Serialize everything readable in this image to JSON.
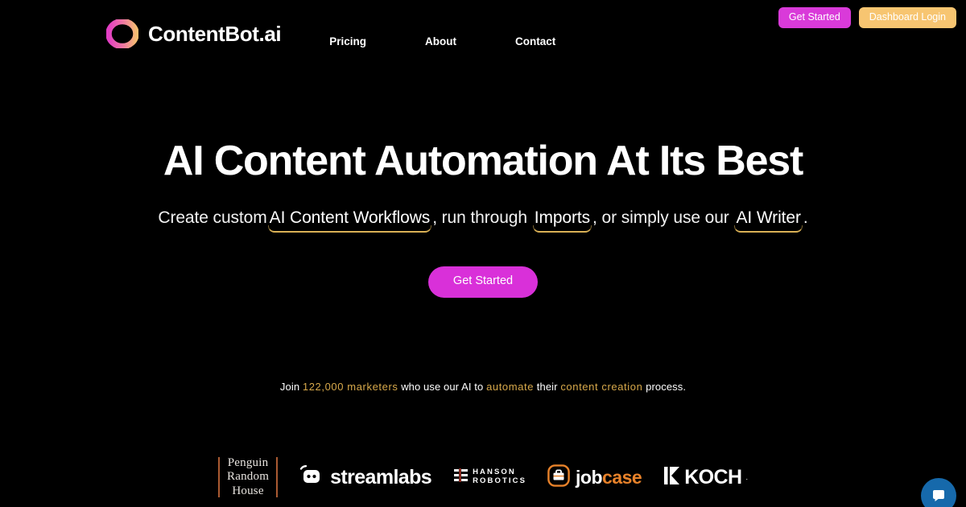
{
  "brand": {
    "name": "ContentBot.ai",
    "logo_icon": "gradient-ring-icon",
    "gradient_start": "#e23ec4",
    "gradient_end": "#f6bd72"
  },
  "nav": {
    "items": [
      {
        "label": "Pricing"
      },
      {
        "label": "About"
      },
      {
        "label": "Contact"
      }
    ]
  },
  "auth": {
    "get_started_label": "Get Started",
    "get_started_color": "#d93ad9",
    "dashboard_login_label": "Dashboard Login",
    "dashboard_login_color": "#f7c571"
  },
  "hero": {
    "title": "AI Content Automation At Its Best",
    "subtitle": {
      "part1": "Create custom",
      "link1": "AI Content Workflows",
      "part2": ", run through",
      "link2": "Imports",
      "part3": ", or simply use our",
      "link3": "AI Writer",
      "part4": ".",
      "underline_color": "#d9b055"
    },
    "cta_label": "Get Started",
    "cta_color": "#d930d9"
  },
  "social_proof": {
    "part1": "Join",
    "highlight1": "122,000 marketers",
    "part2": "who use our AI to",
    "highlight2": "automate",
    "part3": "their",
    "highlight3": "content creation",
    "part4": "process.",
    "highlight_color": "#d8a94b"
  },
  "logos": {
    "penguin": {
      "line1": "Penguin",
      "line2": "Random",
      "line3": "House",
      "rule_color": "#b35f35"
    },
    "streamlabs": {
      "name": "streamlabs",
      "icon": "streamlabs-face-icon"
    },
    "hanson": {
      "line1": "HANSON",
      "line2": "ROBOTICS",
      "icon": "hanson-grid-icon",
      "accent": "#c0392b"
    },
    "jobcase": {
      "name_part1": "job",
      "name_part2": "case",
      "icon": "jobcase-briefcase-icon",
      "accent": "#e8822a"
    },
    "koch": {
      "name": "KOCH",
      "trademark": ".",
      "icon": "koch-chevron-icon"
    }
  },
  "chat": {
    "icon": "chat-bubble-icon",
    "color": "#1669ab"
  }
}
